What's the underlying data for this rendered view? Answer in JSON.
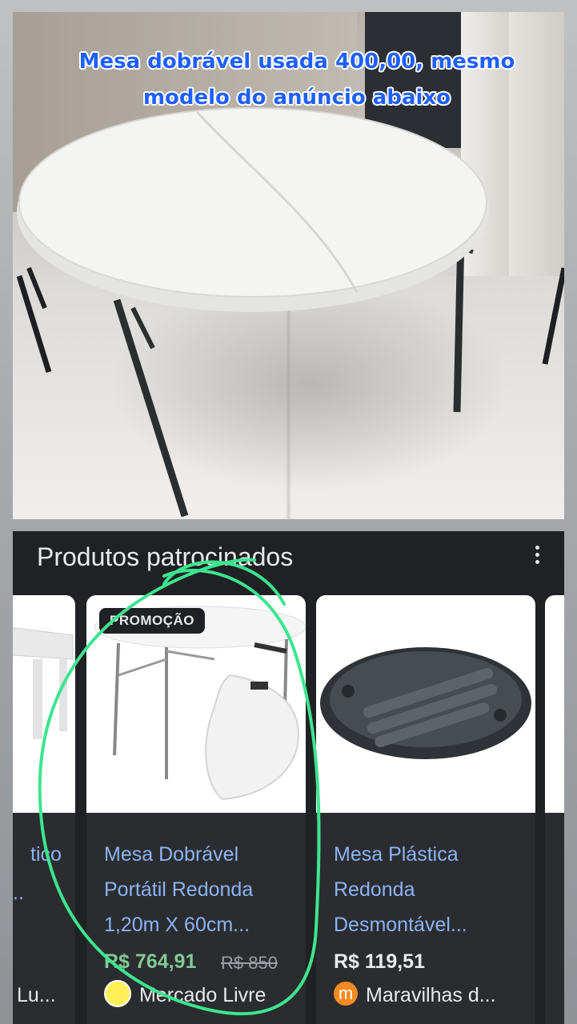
{
  "caption": "Mesa dobrável usada 400,00, mesmo modelo do anúncio abaixo",
  "sponsored": {
    "header": "Produtos patrocinados",
    "more_icon": "more-vert-icon",
    "cards": [
      {
        "title": "tico",
        "title2": "..",
        "store": "Lu..."
      },
      {
        "badge": "PROMOÇÃO",
        "title": "Mesa Dobrável Portátil Redonda 1,20m X 60cm...",
        "price": "R$ 764,91",
        "old_price": "R$ 850",
        "store": "Mercado Livre",
        "store_icon": "mercado-livre-logo-icon"
      },
      {
        "title": "Mesa Plástica Redonda Desmontável...",
        "price": "R$ 119,51",
        "store": "Maravilhas d...",
        "store_icon": "maravilhas-logo-icon"
      }
    ]
  },
  "colors": {
    "link": "#8ab4f8",
    "promo_price": "#81c995",
    "panel_bg": "#202124",
    "annotation": "#3de58f",
    "caption": "#1f5fff"
  }
}
